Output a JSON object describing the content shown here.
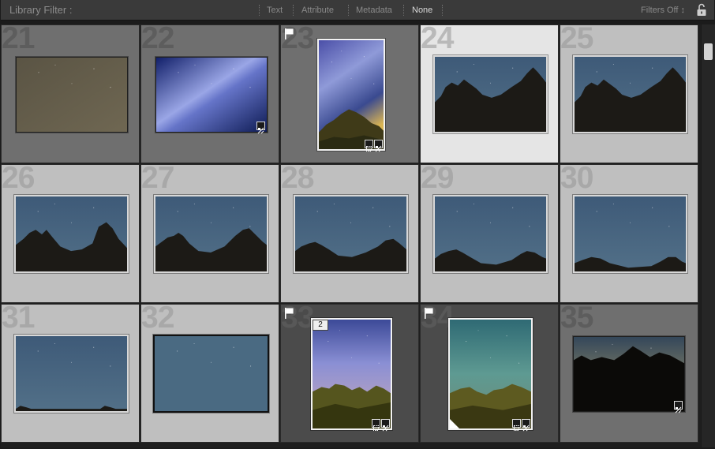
{
  "filter_bar": {
    "label": "Library Filter :",
    "tabs": [
      {
        "label": "Text",
        "active": false
      },
      {
        "label": "Attribute",
        "active": false
      },
      {
        "label": "Metadata",
        "active": false
      },
      {
        "label": "None",
        "active": true
      }
    ],
    "preset": "Filters Off ↕",
    "lock_icon": "padlock-open-icon"
  },
  "cells": [
    {
      "index": "21",
      "flagged": false,
      "selected": false
    },
    {
      "index": "22",
      "flagged": false,
      "selected": false
    },
    {
      "index": "23",
      "flagged": true,
      "selected": false
    },
    {
      "index": "24",
      "flagged": false,
      "selected": true
    },
    {
      "index": "25",
      "flagged": false,
      "selected": false
    },
    {
      "index": "26",
      "flagged": false,
      "selected": false
    },
    {
      "index": "27",
      "flagged": false,
      "selected": false
    },
    {
      "index": "28",
      "flagged": false,
      "selected": false
    },
    {
      "index": "29",
      "flagged": false,
      "selected": false
    },
    {
      "index": "30",
      "flagged": false,
      "selected": false
    },
    {
      "index": "31",
      "flagged": false,
      "selected": false
    },
    {
      "index": "32",
      "flagged": false,
      "selected": false
    },
    {
      "index": "33",
      "flagged": true,
      "selected": false,
      "stack_count": "2"
    },
    {
      "index": "34",
      "flagged": true,
      "selected": false
    },
    {
      "index": "35",
      "flagged": false,
      "selected": false
    }
  ],
  "colors": {
    "cell_dark": "#6f6f6f",
    "cell_light": "#bfbfbf",
    "cell_selected": "#e5e5e5",
    "cell_stack": "#4b4b4b"
  }
}
